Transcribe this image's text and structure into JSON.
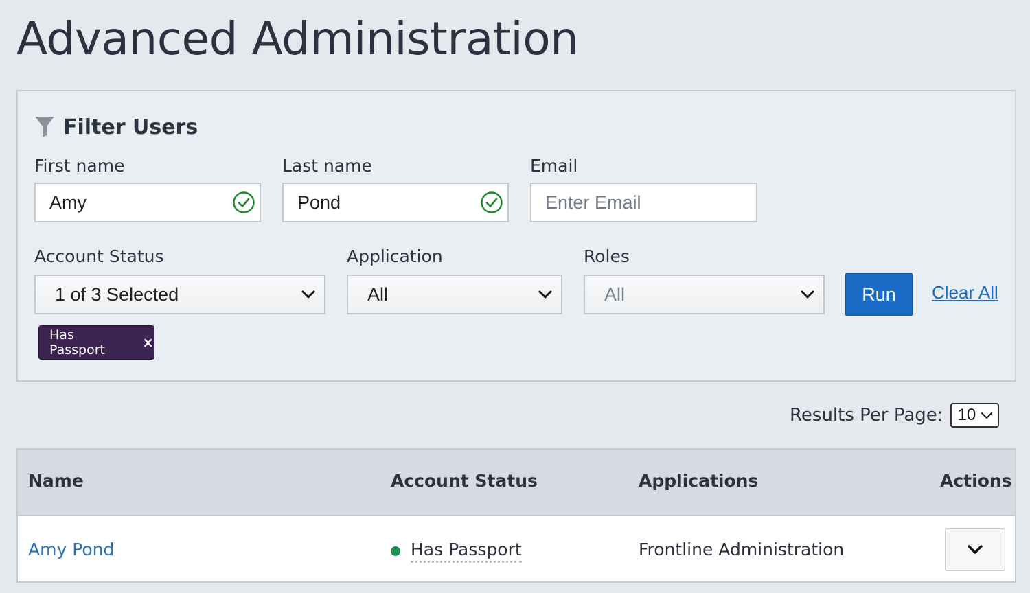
{
  "page": {
    "title": "Advanced Administration"
  },
  "filter": {
    "heading": "Filter Users",
    "first_name": {
      "label": "First name",
      "value": "Amy",
      "valid": true
    },
    "last_name": {
      "label": "Last name",
      "value": "Pond",
      "valid": true
    },
    "email": {
      "label": "Email",
      "value": "",
      "placeholder": "Enter Email"
    },
    "account_status": {
      "label": "Account Status",
      "selected": "1 of 3 Selected"
    },
    "application": {
      "label": "Application",
      "selected": "All"
    },
    "roles": {
      "label": "Roles",
      "selected": "All",
      "disabled": true
    },
    "run_label": "Run",
    "clear_label": "Clear All",
    "chips": [
      {
        "label": "Has Passport",
        "remove_symbol": "×"
      }
    ]
  },
  "results_per_page": {
    "label": "Results Per Page:",
    "value": "10"
  },
  "table": {
    "columns": [
      "Name",
      "Account Status",
      "Applications",
      "Actions"
    ],
    "rows": [
      {
        "name": "Amy Pond",
        "status": "Has Passport",
        "status_color": "#1e8e4e",
        "applications": "Frontline Administration"
      }
    ]
  },
  "colors": {
    "accent": "#1a6cc7",
    "chip": "#3d2351",
    "valid": "#1e8a2e",
    "link": "#2a72b5"
  },
  "icons": [
    "filter-icon",
    "check-circle-icon",
    "chevron-down-icon"
  ]
}
